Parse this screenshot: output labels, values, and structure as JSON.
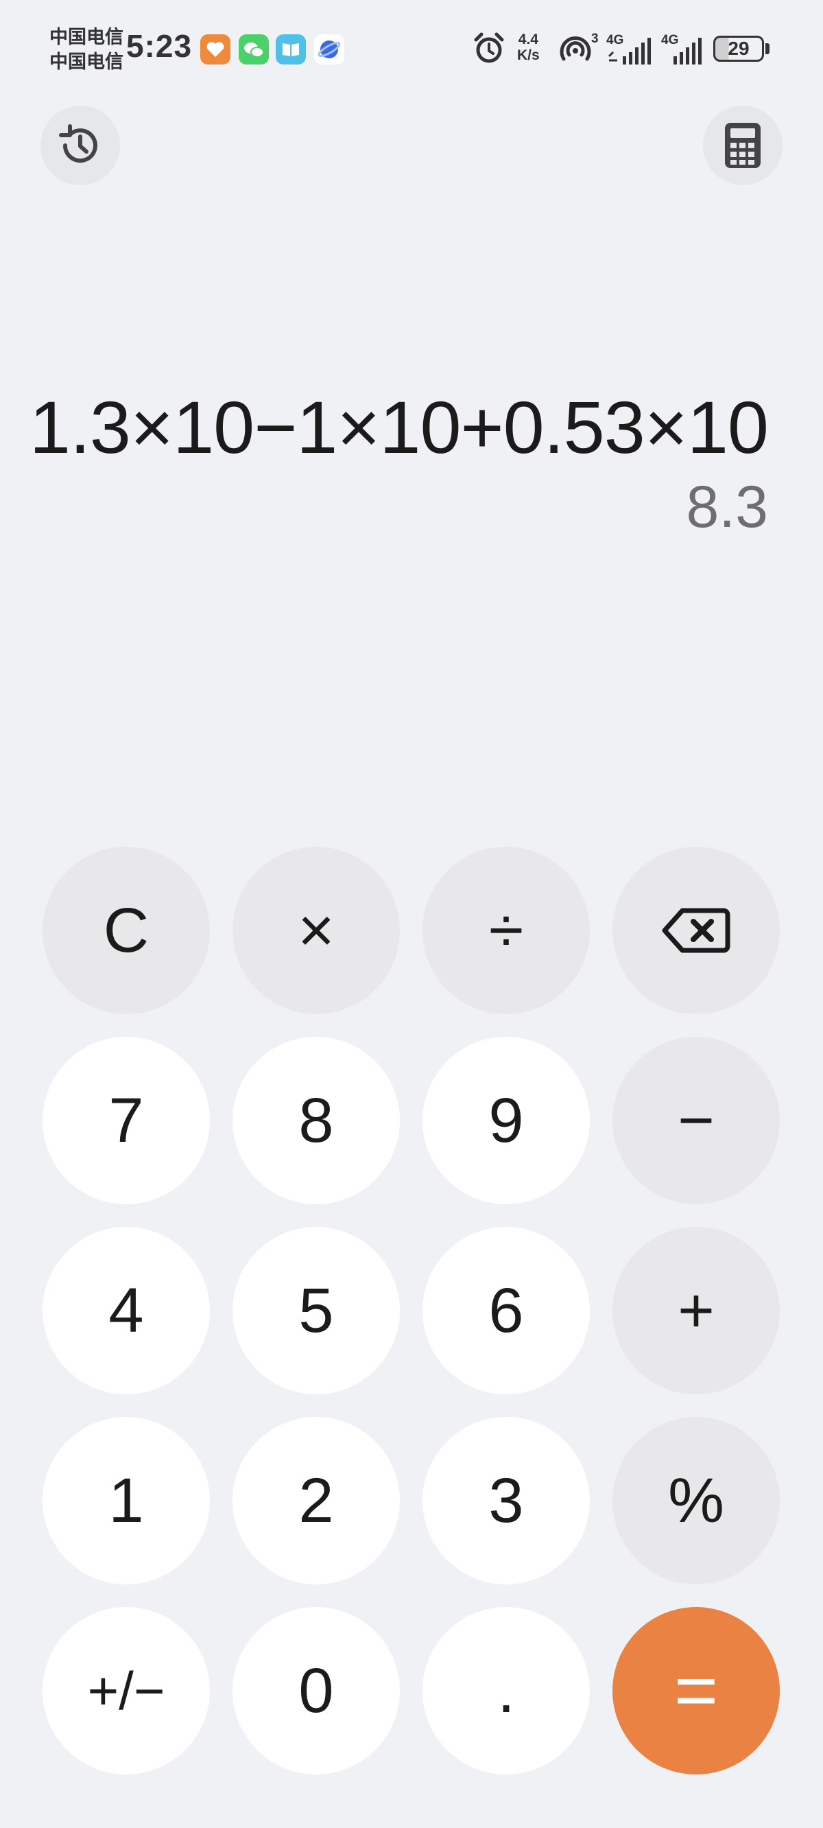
{
  "status_bar": {
    "carrier_1": "中国电信",
    "carrier_2": "中国电信",
    "time": "5:23",
    "net_speed_value": "4.4",
    "net_speed_unit": "K/s",
    "hotspot_count": "3",
    "sim1_net": "4G",
    "sim2_net": "4G",
    "battery": "29",
    "app_icons": [
      "health-app-icon",
      "wechat-icon",
      "reader-app-icon",
      "browser-app-icon"
    ],
    "colors": {
      "health": "#f08a3b",
      "wechat": "#4cd069",
      "reader": "#4fc1e9",
      "browser": "#3a6ae0"
    }
  },
  "top_buttons": {
    "history_icon": "history-icon",
    "mode_icon": "calculator-mode-icon"
  },
  "display": {
    "expression": "1.3×10−1×10+0.53×10",
    "result": "8.3"
  },
  "keypad": {
    "row1": [
      "C",
      "×",
      "÷",
      "⌫"
    ],
    "row2": [
      "7",
      "8",
      "9",
      "−"
    ],
    "row3": [
      "4",
      "5",
      "6",
      "+"
    ],
    "row4": [
      "1",
      "2",
      "3",
      "%"
    ],
    "row5": [
      "+/−",
      "0",
      ".",
      "="
    ]
  },
  "colors": {
    "background": "#f0f1f5",
    "number_key": "#ffffff",
    "operator_key": "#e8e8ea",
    "equals_key": "#ea8243",
    "result_text": "#6e6e6e"
  }
}
